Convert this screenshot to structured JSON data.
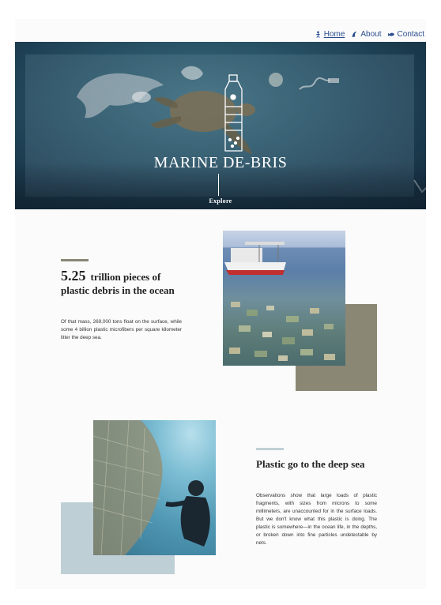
{
  "nav": {
    "items": [
      {
        "label": "Home",
        "icon": "diver-icon"
      },
      {
        "label": "About",
        "icon": "wave-icon"
      },
      {
        "label": "Contact",
        "icon": "fish-icon"
      }
    ],
    "link_color": "#2a4d8f"
  },
  "hero": {
    "title": "MARINE DE-BRIS",
    "cta": "Explore",
    "logo": "plastic-bottle-icon"
  },
  "section1": {
    "stat_number": "5.25",
    "stat_text_line1": "trillion pieces of",
    "stat_text_line2": "plastic debris in the ocean",
    "paragraph": "Of that mass, 269,000 tons float on the surface, while some 4 billion plastic microfibers per square kilometer litter the deep sea.",
    "accent_color": "#8a8774"
  },
  "section2": {
    "heading": "Plastic go to the deep sea",
    "paragraph": "Observations show that large loads of plastic fragments, with sizes from microns to some millimeters, are unaccounted for in the surface loads. But we don't know what this plastic is doing. The plastic is somewhere—in the ocean life, in the depths, or broken down into fine particles undetectable by nets.",
    "accent_color": "#bfcfd6"
  }
}
